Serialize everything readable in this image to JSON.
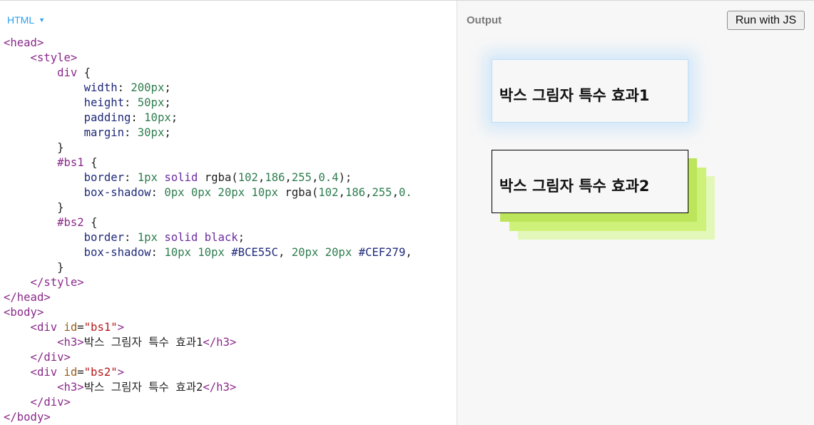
{
  "editor": {
    "language": "HTML",
    "lines": [
      [
        [
          "t-tag",
          "<head>"
        ]
      ],
      [
        [
          "t-tag",
          "    <style>"
        ]
      ],
      [
        [
          "t-sel",
          "        div "
        ],
        [
          "t-txt",
          "{"
        ]
      ],
      [
        [
          "t-prop",
          "            width"
        ],
        [
          "t-txt",
          ": "
        ],
        [
          "t-num",
          "200px"
        ],
        [
          "t-txt",
          ";"
        ]
      ],
      [
        [
          "t-prop",
          "            height"
        ],
        [
          "t-txt",
          ": "
        ],
        [
          "t-num",
          "50px"
        ],
        [
          "t-txt",
          ";"
        ]
      ],
      [
        [
          "t-prop",
          "            padding"
        ],
        [
          "t-txt",
          ": "
        ],
        [
          "t-num",
          "10px"
        ],
        [
          "t-txt",
          ";"
        ]
      ],
      [
        [
          "t-prop",
          "            margin"
        ],
        [
          "t-txt",
          ": "
        ],
        [
          "t-num",
          "30px"
        ],
        [
          "t-txt",
          ";"
        ]
      ],
      [
        [
          "t-txt",
          "        }"
        ]
      ],
      [
        [
          "t-sel",
          "        #bs1 "
        ],
        [
          "t-txt",
          "{"
        ]
      ],
      [
        [
          "t-prop",
          "            border"
        ],
        [
          "t-txt",
          ": "
        ],
        [
          "t-num",
          "1px "
        ],
        [
          "t-kw",
          "solid "
        ],
        [
          "t-txt",
          "rgba("
        ],
        [
          "t-num",
          "102"
        ],
        [
          "t-txt",
          ","
        ],
        [
          "t-num",
          "186"
        ],
        [
          "t-txt",
          ","
        ],
        [
          "t-num",
          "255"
        ],
        [
          "t-txt",
          ","
        ],
        [
          "t-num",
          "0.4"
        ],
        [
          "t-txt",
          ");"
        ]
      ],
      [
        [
          "t-prop",
          "            box-shadow"
        ],
        [
          "t-txt",
          ": "
        ],
        [
          "t-num",
          "0px 0px 20px 10px "
        ],
        [
          "t-txt",
          "rgba("
        ],
        [
          "t-num",
          "102"
        ],
        [
          "t-txt",
          ","
        ],
        [
          "t-num",
          "186"
        ],
        [
          "t-txt",
          ","
        ],
        [
          "t-num",
          "255"
        ],
        [
          "t-txt",
          ","
        ],
        [
          "t-num",
          "0."
        ]
      ],
      [
        [
          "t-txt",
          "        }"
        ]
      ],
      [
        [
          "t-sel",
          "        #bs2 "
        ],
        [
          "t-txt",
          "{"
        ]
      ],
      [
        [
          "t-prop",
          "            border"
        ],
        [
          "t-txt",
          ": "
        ],
        [
          "t-num",
          "1px "
        ],
        [
          "t-kw",
          "solid black"
        ],
        [
          "t-txt",
          ";"
        ]
      ],
      [
        [
          "t-prop",
          "            box-shadow"
        ],
        [
          "t-txt",
          ": "
        ],
        [
          "t-num",
          "10px 10px "
        ],
        [
          "t-prop",
          "#BCE55C"
        ],
        [
          "t-txt",
          ", "
        ],
        [
          "t-num",
          "20px 20px "
        ],
        [
          "t-prop",
          "#CEF279"
        ],
        [
          "t-txt",
          ","
        ]
      ],
      [
        [
          "t-txt",
          "        }"
        ]
      ],
      [
        [
          "t-tag",
          "    </style>"
        ]
      ],
      [
        [
          "t-tag",
          "</head>"
        ]
      ],
      [
        [
          "t-tag",
          "<body>"
        ]
      ],
      [
        [
          "t-tag",
          "    <div "
        ],
        [
          "t-attr",
          "id"
        ],
        [
          "t-txt",
          "="
        ],
        [
          "t-str",
          "\"bs1\""
        ],
        [
          "t-tag",
          ">"
        ]
      ],
      [
        [
          "t-tag",
          "        <h3>"
        ],
        [
          "t-txt",
          "박스 그림자 특수 효과1"
        ],
        [
          "t-tag",
          "</h3>"
        ]
      ],
      [
        [
          "t-tag",
          "    </div>"
        ]
      ],
      [
        [
          "t-tag",
          "    <div "
        ],
        [
          "t-attr",
          "id"
        ],
        [
          "t-txt",
          "="
        ],
        [
          "t-str",
          "\"bs2\""
        ],
        [
          "t-tag",
          ">"
        ]
      ],
      [
        [
          "t-tag",
          "        <h3>"
        ],
        [
          "t-txt",
          "박스 그림자 특수 효과2"
        ],
        [
          "t-tag",
          "</h3>"
        ]
      ],
      [
        [
          "t-tag",
          "    </div>"
        ]
      ],
      [
        [
          "t-tag",
          "</body>"
        ]
      ]
    ]
  },
  "output": {
    "label": "Output",
    "run_button": "Run with JS",
    "box1_text": "박스 그림자 특수 효과1",
    "box2_text": "박스 그림자 특수 효과2"
  },
  "colors": {
    "language_accent": "#2aa0ef",
    "shadow_1": "#BCE55C",
    "shadow_2": "#CEF279",
    "box1_border": "rgba(102,186,255,0.4)"
  },
  "icons": {
    "language_dropdown": "caret-down-icon"
  }
}
